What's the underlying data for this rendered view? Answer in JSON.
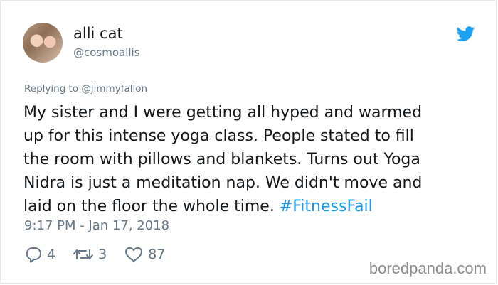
{
  "author": {
    "display_name": "alli cat",
    "handle": "@cosmoallis"
  },
  "tweet": {
    "replying_to": "Replying to @jimmyfallon",
    "lines": [
      "My sister and I were getting all hyped and warmed",
      "up for this intense yoga class. People stated to fill",
      "the room with pillows and blankets. Turns out Yoga",
      "Nidra is just a meditation nap. We didn't move and",
      "laid on the floor the whole time."
    ],
    "hashtag": "#FitnessFail",
    "timestamp": "9:17 PM - Jan 17, 2018"
  },
  "actions": {
    "replies": "4",
    "retweets": "3",
    "likes": "87"
  },
  "watermark": "boredpanda.com",
  "colors": {
    "text": "#14171a",
    "muted": "#657786",
    "link": "#1b95e0",
    "twitter_blue": "#1da1f2"
  },
  "icons": [
    "twitter-bird-icon",
    "reply-icon",
    "retweet-icon",
    "like-heart-icon"
  ]
}
